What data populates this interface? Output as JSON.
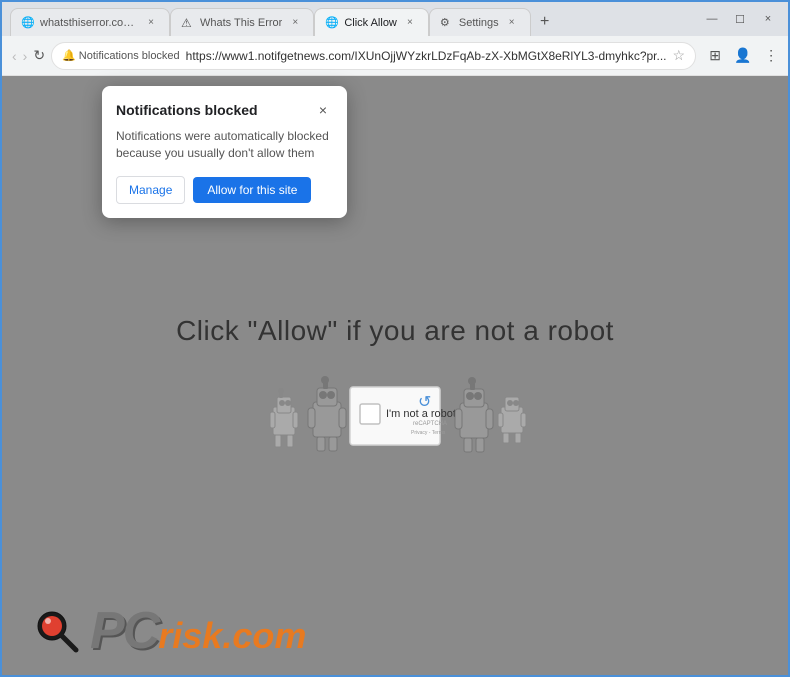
{
  "browser": {
    "tabs": [
      {
        "id": "tab1",
        "label": "whatsthiserror.com/b...",
        "active": false,
        "favicon": "globe"
      },
      {
        "id": "tab2",
        "label": "Whats This Error",
        "active": false,
        "favicon": "warning"
      },
      {
        "id": "tab3",
        "label": "Click Allow",
        "active": true,
        "favicon": "globe"
      },
      {
        "id": "tab4",
        "label": "Settings",
        "active": false,
        "favicon": "gear"
      }
    ],
    "address_bar": {
      "security_label": "Notifications blocked",
      "url": "https://www1.notifgetnews.com/IXUnOjjWYzkrLDzFqAb-zX-XbMGtX8eRlYL3-dmyhkc?pr..."
    },
    "nav": {
      "back": "‹",
      "forward": "›",
      "reload": "↻"
    }
  },
  "notification_popup": {
    "title": "Notifications blocked",
    "message": "Notifications were automatically blocked because you usually don't allow them",
    "close_icon": "×",
    "manage_label": "Manage",
    "allow_label": "Allow for this site"
  },
  "page": {
    "headline": "Click \"Allow\"  if you are not   a robot",
    "recaptcha": {
      "checkbox_label": "I'm not a robot",
      "brand": "reCAPTCHA",
      "sub_text": "Privacy - Terms"
    }
  },
  "pcrisk": {
    "text_pc": "PC",
    "text_risk": "risk",
    "text_dot": ".",
    "text_com": "com"
  }
}
